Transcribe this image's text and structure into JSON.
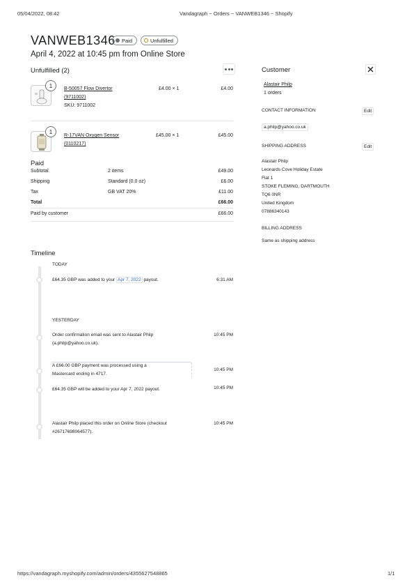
{
  "print": {
    "datetime": "05/04/2022, 08:42",
    "doc_title": "Vandagraph ~ Orders ~ VANWEB1346 ~ Shopify",
    "url": "https://vandagraph.myshopify.com/admin/orders/4355627548865",
    "page": "1/1"
  },
  "order": {
    "number": "VANWEB1346",
    "payment_badge": "Paid",
    "fulfillment_badge": "Unfulfilled",
    "placed": "April 4, 2022 at 10:45 pm from Online Store",
    "colors": {
      "paid_dot": "#6d7175",
      "unfulfilled_dot": "#b98900"
    }
  },
  "unfulfilled": {
    "title": "Unfulfilled (2)",
    "more_icon": "more-horizontal-icon",
    "items": [
      {
        "qty": "1",
        "name_line1": "B-50057 Flow Divertor",
        "name_line2": "(9711002)",
        "sku": "SKU: 9711002",
        "price_qty": "£4.00 × 1",
        "total": "£4.00"
      },
      {
        "qty": "1",
        "name_line1": "R-17VAN Oxygen Sensor",
        "name_line2": "(0110217)",
        "sku": "",
        "price_qty": "£45.00 × 1",
        "total": "£45.00"
      }
    ]
  },
  "paid": {
    "title": "Paid",
    "rows": [
      {
        "label": "Subtotal",
        "detail": "2 items",
        "amount": "£49.00"
      },
      {
        "label": "Shipping",
        "detail": "Standard (0.0 oz)",
        "amount": "£6.00"
      },
      {
        "label": "Tax",
        "detail": "GB VAT 20%",
        "amount": "£11.00"
      }
    ],
    "total_label": "Total",
    "total_amount": "£66.00",
    "paid_by_label": "Paid by customer",
    "paid_by_amount": "£66.00"
  },
  "timeline": {
    "title": "Timeline",
    "today_label": "TODAY",
    "yesterday_label": "YESTERDAY",
    "e1_pre": "£64.35 GBP was added to your ",
    "e1_link": "Apr 7, 2022",
    "e1_post": " payout.",
    "e1_time": "6:31 AM",
    "e2_line1": "Order confirmation email was sent to Alastair Philp",
    "e2_line2": "(a.philp@yahoo.co.uk).",
    "e2_time": "10:45 PM",
    "e3_line1": "A £66.00 GBP payment was processed using a",
    "e3_line2": "Mastercard ending in 4717.",
    "e3_time": "10:45 PM",
    "e4_text": "£64.35 GBP will be added to your Apr 7, 2022 payout.",
    "e4_time": "10:45 PM",
    "e5_line1": "Alastair Philp placed this order on Online Store (checkout",
    "e5_line2": "#26717698064577).",
    "e5_time": "10:45 PM"
  },
  "customer": {
    "title": "Customer",
    "close_icon": "close-icon",
    "name": "Alastair Philp",
    "orders": "1 orders",
    "contact_title": "CONTACT INFORMATION",
    "contact_edit": "Edit",
    "email": "a.philp@yahoo.co.uk",
    "shipping_title": "SHIPPING ADDRESS",
    "shipping_edit": "Edit",
    "shipping_lines": [
      "Alastair Philp",
      "Leonards Cove Holiday Estate",
      "Flat 1",
      "STOKE FLEMING, DARTMOUTH",
      "TQ6 0NR",
      "United Kingdom",
      "07886340143"
    ],
    "billing_title": "BILLING ADDRESS",
    "billing_text": "Same as shipping address"
  }
}
